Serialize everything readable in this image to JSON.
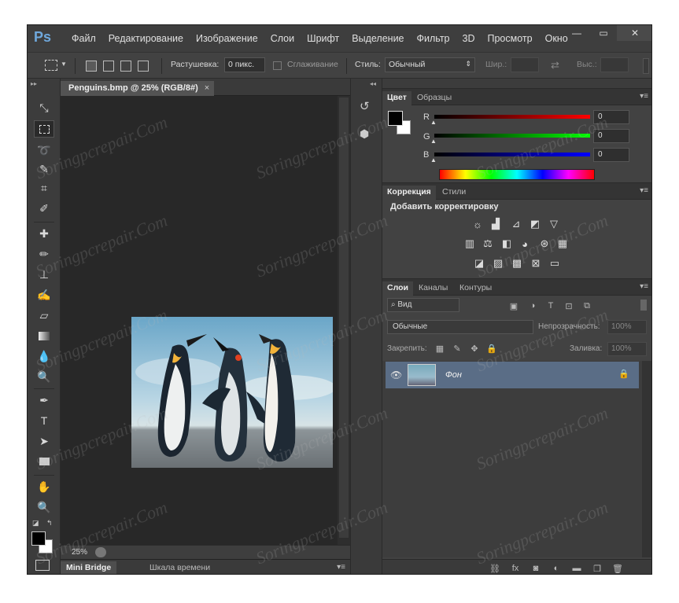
{
  "app": {
    "logo": "Ps"
  },
  "menu": [
    "Файл",
    "Редактирование",
    "Изображение",
    "Слои",
    "Шрифт",
    "Выделение",
    "Фильтр",
    "3D",
    "Просмотр",
    "Окно"
  ],
  "window_controls": {
    "minimize": "—",
    "maximize": "▭",
    "close": "✕"
  },
  "options": {
    "feather_label": "Растушевка:",
    "feather_value": "0 пикс.",
    "antialias_label": "Сглаживание",
    "style_label": "Стиль:",
    "style_value": "Обычный",
    "width_label": "Шир.:",
    "height_label": "Выс.:"
  },
  "document": {
    "tab_title": "Penguins.bmp @ 25% (RGB/8#)",
    "tab_close": "×",
    "zoom": "25%"
  },
  "bottom_tabs": [
    "Mini Bridge",
    "Шкала времени"
  ],
  "color_panel": {
    "tabs": [
      "Цвет",
      "Образцы"
    ],
    "channels": [
      {
        "label": "R",
        "value": "0"
      },
      {
        "label": "G",
        "value": "0"
      },
      {
        "label": "B",
        "value": "0"
      }
    ]
  },
  "adjustments": {
    "tabs": [
      "Коррекция",
      "Стили"
    ],
    "title": "Добавить корректировку"
  },
  "layers": {
    "tabs": [
      "Слои",
      "Каналы",
      "Контуры"
    ],
    "filter_value": "Вид",
    "blend_mode": "Обычные",
    "opacity_label": "Непрозрачность:",
    "opacity_value": "100%",
    "lock_label": "Закрепить:",
    "fill_label": "Заливка:",
    "fill_value": "100%",
    "layer_name": "Фон"
  },
  "watermark": "Soringpcrepair.Com",
  "colors": {
    "accent": "#5a6d86",
    "panel_bg": "#424242",
    "canvas_bg": "#282828",
    "logo": "#6fa8dc"
  }
}
